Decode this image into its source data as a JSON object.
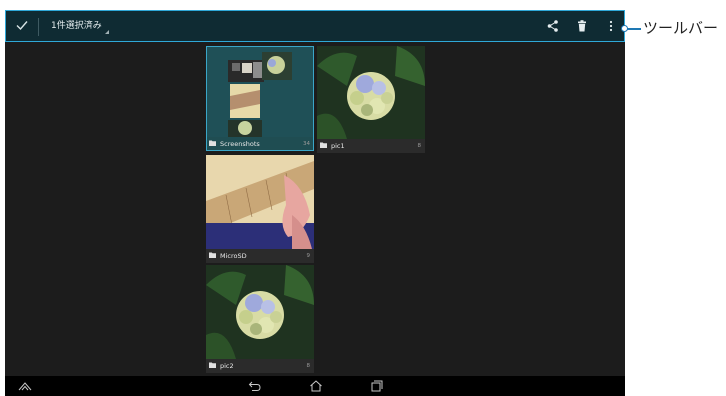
{
  "action_bar": {
    "title": "1件選択済み",
    "icons": [
      "check-icon",
      "share-icon",
      "trash-icon",
      "overflow-menu-icon"
    ]
  },
  "callout": {
    "label": "ツールバー"
  },
  "albums": [
    {
      "name": "Screenshots",
      "count": "34",
      "selected": true
    },
    {
      "name": "pic1",
      "count": "8",
      "selected": false
    },
    {
      "name": "MicroSD",
      "count": "9",
      "selected": false
    },
    {
      "name": "pic2",
      "count": "8",
      "selected": false
    }
  ],
  "nav_bar": {
    "icons": [
      "up-icon",
      "back-icon",
      "home-icon",
      "recent-apps-icon"
    ]
  },
  "colors": {
    "accent": "#2fa8d8",
    "action_bar_bg": "#0f2b33",
    "screen_bg": "#1c1c1c"
  }
}
